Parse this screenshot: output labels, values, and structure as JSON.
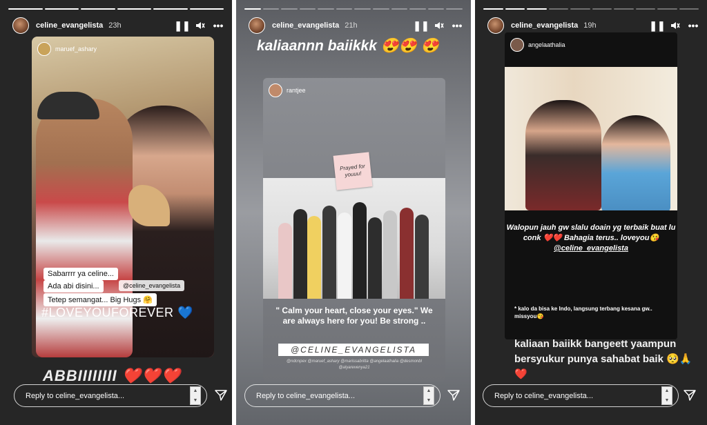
{
  "stories": [
    {
      "author": "celine_evangelista",
      "age": "23h",
      "repost_user": "maruef_ashary",
      "stickers": [
        "Sabarrrr ya celine...",
        "Ada abi disini...",
        "@celine_evangelista",
        "Tetep semangat... Big Hugs 🤗",
        "#LOVEYOUFOREVER 💙"
      ],
      "caption": "ABBIIIIIIII ❤️❤️❤️",
      "reply_placeholder": "Reply to celine_evangelista..."
    },
    {
      "author": "celine_evangelista",
      "age": "21h",
      "top_text": "kaliaannn baiikkk 😍😍 😍",
      "repost_user": "rantjee",
      "note_text": "Prayed for youuu!",
      "quote": "\" Calm your heart, close your eyes.\" We are always here for you! Be strong ..",
      "tag": "@CELINE_EVANGELISTA",
      "mentions": "@ndcnpex @maruef_ashary @marissabritta @angelaathalia @desmonbl @alyarevenya21",
      "reply_placeholder": "Reply to celine_evangelista..."
    },
    {
      "author": "celine_evangelista",
      "age": "19h",
      "repost_user": "angelaathalia",
      "text1": "Walopun jauh gw slalu doain yg terbaik buat lu conk ❤️❤️ Bahagia terus.. loveyou😘",
      "text1_mention": "@celine_evangelista",
      "text2": "* kalo da bisa ke Indo, langsung terbang kesana gw.. missyou😘",
      "caption": "kaliaan baiikk bangeett yaampun bersyukur punya sahabat baik 🥺🙏❤️",
      "reply_placeholder": "Reply to celine_evangelista..."
    }
  ],
  "icons": {
    "pause": "pause-icon",
    "mute": "mute-icon",
    "more": "more-icon",
    "send": "send-icon"
  },
  "colors": {
    "panel_bg": "#262626",
    "heart": "#e0242f"
  }
}
